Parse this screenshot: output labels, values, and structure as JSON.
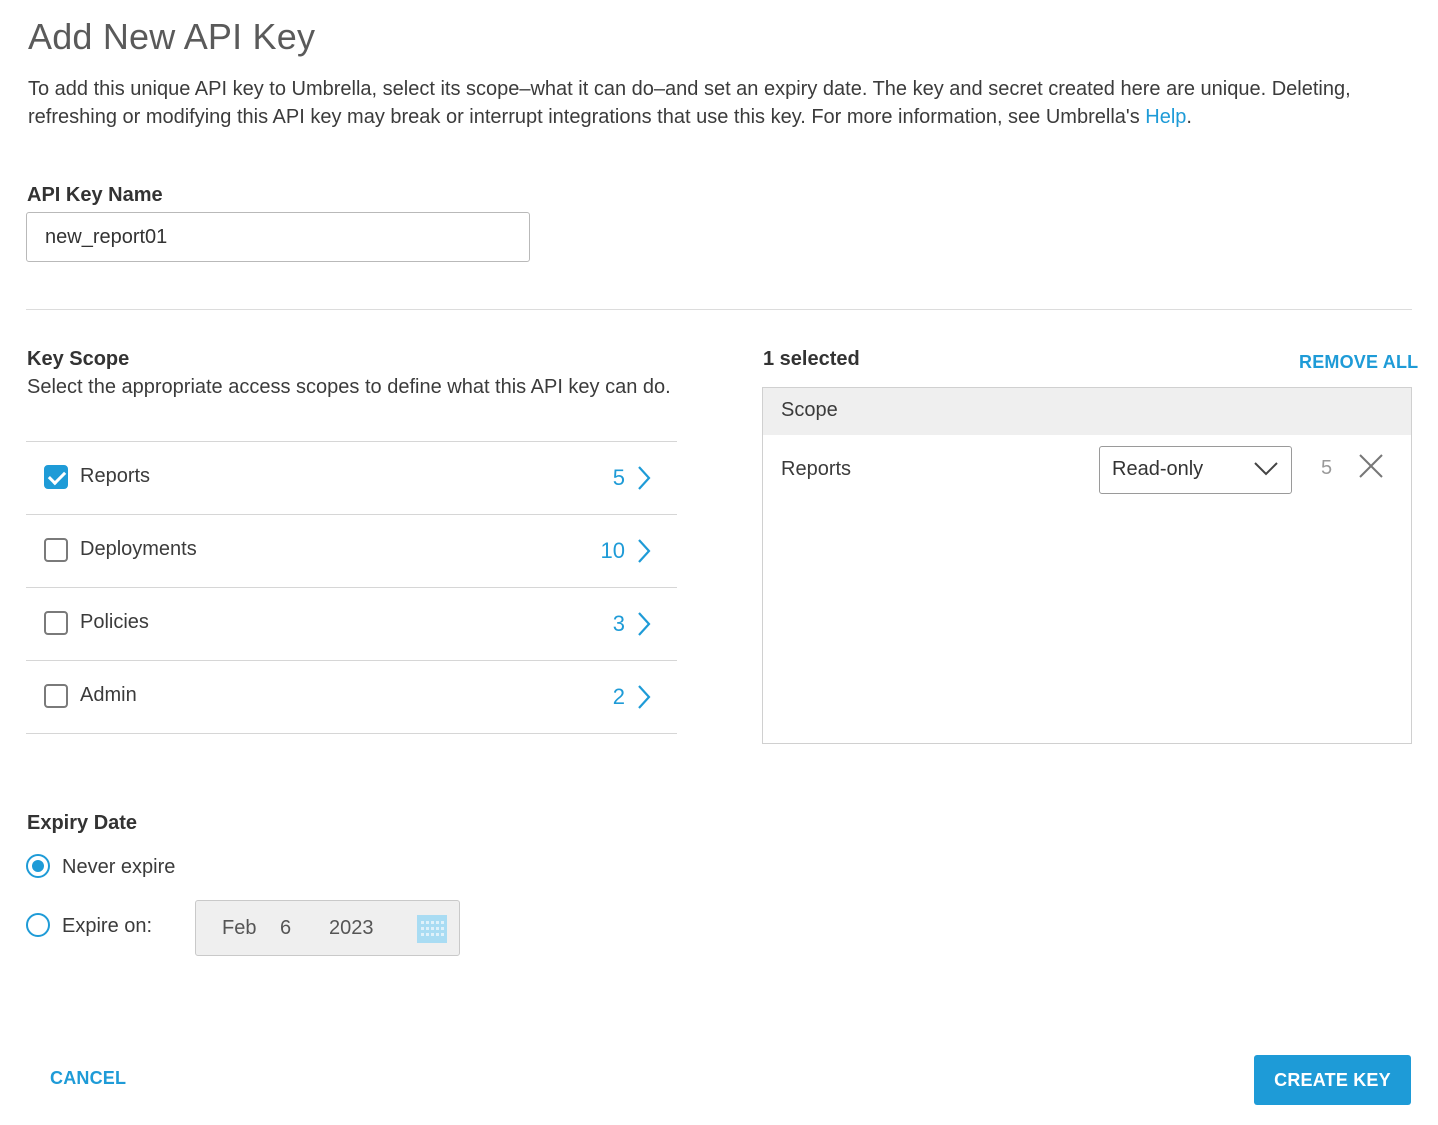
{
  "page": {
    "title": "Add New API Key",
    "description": "To add this unique API key to Umbrella, select its scope–what it can do–and set an expiry date. The key and secret created here are unique. Deleting, refreshing or modifying this API key may break or interrupt integrations that use this key. For more information, see Umbrella's ",
    "help_link": "Help",
    "description_end": "."
  },
  "api_key_name": {
    "label": "API Key Name",
    "value": "new_report01"
  },
  "key_scope": {
    "label": "Key Scope",
    "description": "Select the appropriate access scopes to define what this API key can do.",
    "items": [
      {
        "label": "Reports",
        "count": "5",
        "checked": true
      },
      {
        "label": "Deployments",
        "count": "10",
        "checked": false
      },
      {
        "label": "Policies",
        "count": "3",
        "checked": false
      },
      {
        "label": "Admin",
        "count": "2",
        "checked": false
      }
    ]
  },
  "selected": {
    "label": "1 selected",
    "remove_all": "REMOVE ALL",
    "column_header": "Scope",
    "rows": [
      {
        "name": "Reports",
        "access": "Read-only",
        "count": "5"
      }
    ]
  },
  "expiry": {
    "label": "Expiry Date",
    "never_label": "Never expire",
    "expire_on_label": "Expire on:",
    "selected_option": "never",
    "date": {
      "month": "Feb",
      "day": "6",
      "year": "2023"
    }
  },
  "actions": {
    "cancel": "CANCEL",
    "create": "CREATE KEY"
  },
  "colors": {
    "accent": "#1e9bd7",
    "header_bg": "#efefef",
    "border": "#d6d6d6"
  },
  "icons": {
    "row_chevron": "chevron-right-icon",
    "select_chevron": "chevron-down-icon",
    "remove": "close-icon",
    "calendar": "calendar-icon"
  }
}
